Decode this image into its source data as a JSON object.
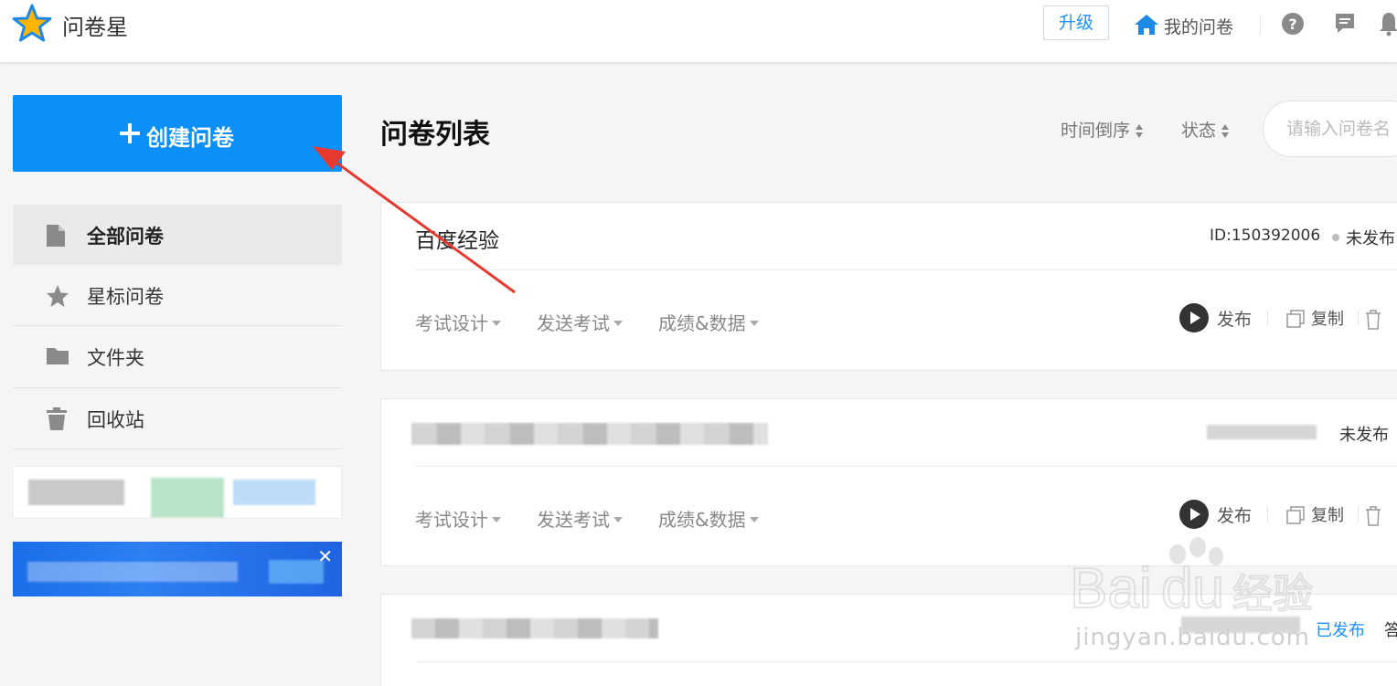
{
  "header": {
    "app_name": "问卷星",
    "upgrade_label": "升级",
    "my_surveys_label": "我的问卷",
    "help_icon": "question-circle-icon",
    "message_icon": "chat-bubble-icon",
    "bell_icon": "bell-icon"
  },
  "sidebar": {
    "create_label": "创建问卷",
    "items": [
      {
        "label": "全部问卷",
        "icon": "document-icon",
        "active": true
      },
      {
        "label": "星标问卷",
        "icon": "star-icon",
        "active": false
      },
      {
        "label": "文件夹",
        "icon": "folder-icon",
        "active": false
      },
      {
        "label": "回收站",
        "icon": "trash-icon",
        "active": false
      }
    ],
    "banner_close": "✕"
  },
  "main": {
    "title": "问卷列表",
    "sort_time": "时间倒序",
    "sort_status": "状态",
    "search_placeholder": "请输入问卷名",
    "cards": [
      {
        "title": "百度经验",
        "id": "ID:150392006",
        "status": "未发布",
        "menus": [
          "考试设计",
          "发送考试",
          "成绩&数据"
        ],
        "actions": {
          "publish": "发布",
          "copy": "复制"
        }
      },
      {
        "title": "",
        "id": "",
        "status": "未发布",
        "menus": [
          "考试设计",
          "发送考试",
          "成绩&数据"
        ],
        "actions": {
          "publish": "发布",
          "copy": "复制"
        }
      },
      {
        "title": "",
        "id": "",
        "status": "已发布",
        "extra": "答"
      }
    ]
  },
  "colors": {
    "primary_blue": "#0b8ff8",
    "arrow_red": "#e8392f",
    "published_blue": "#1e90ff"
  },
  "watermark": {
    "brand": "Bai du 经验",
    "url": "jingyan.baidu.com"
  }
}
